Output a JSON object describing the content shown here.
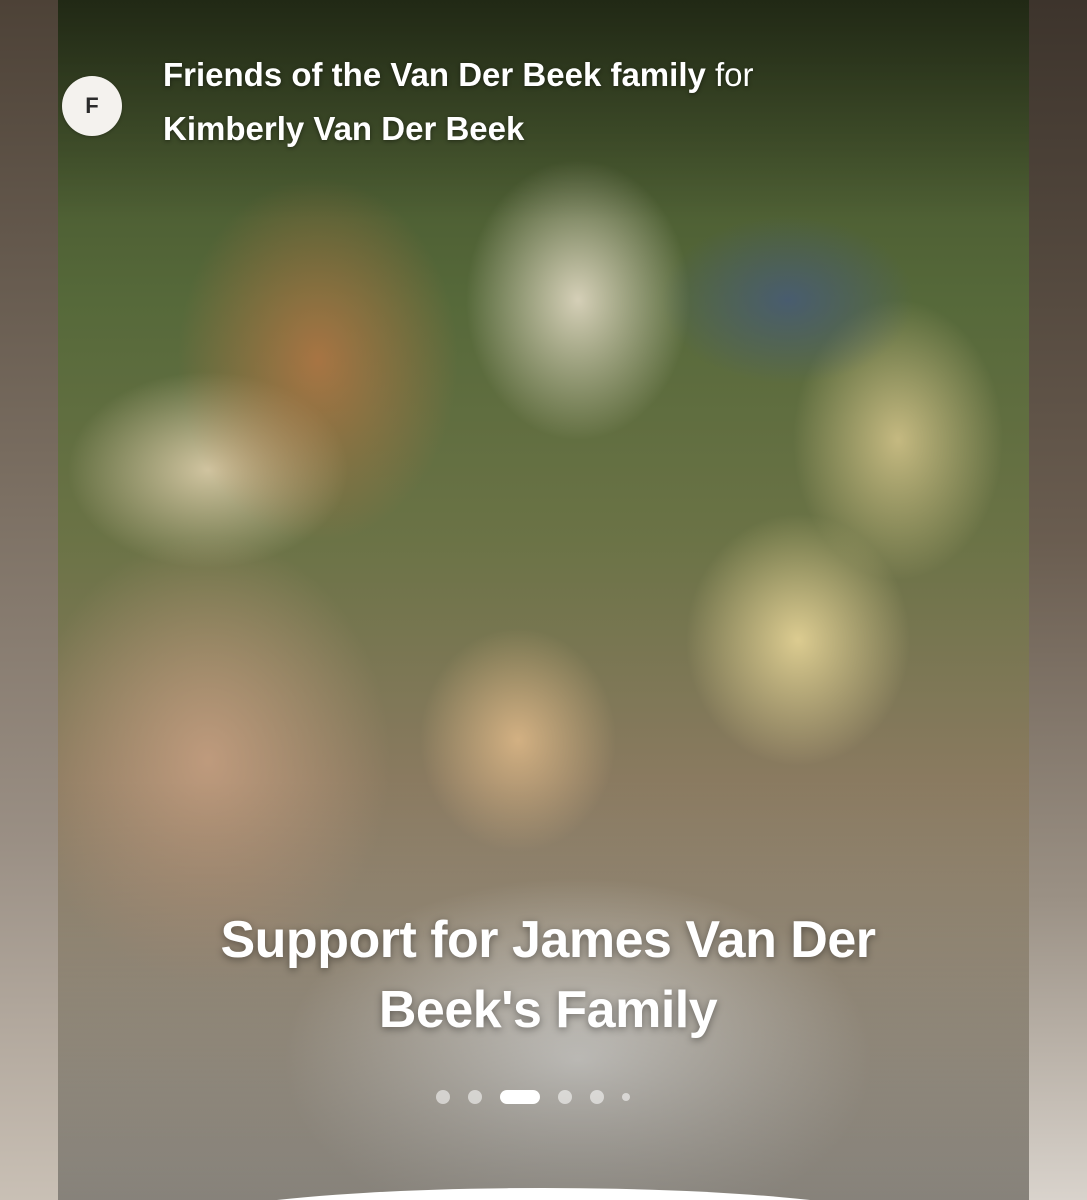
{
  "campaign": {
    "organizer_initial": "F",
    "organizer_name": "Friends of the Van Der Beek family",
    "connector": "for",
    "beneficiary_name": "Kimberly Van Der Beek",
    "title": "Support for James Van Der Beek's Family"
  },
  "carousel": {
    "total_slides": 6,
    "active_index": 2
  },
  "icons": {
    "avatar": "organizer-avatar"
  }
}
